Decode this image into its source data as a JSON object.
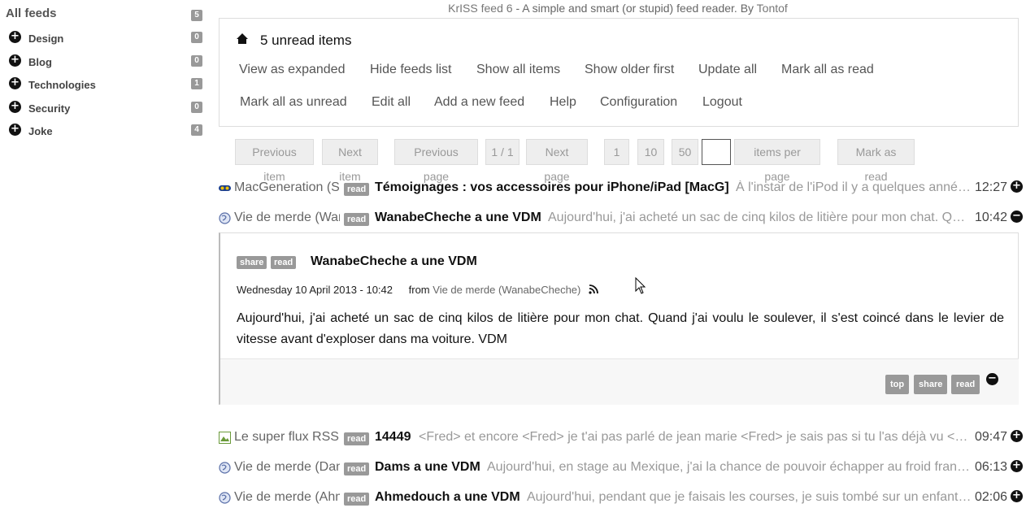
{
  "sidebar": {
    "all_feeds": "All feeds",
    "all_count": "5",
    "folders": [
      {
        "label": "Design",
        "count": "0"
      },
      {
        "label": "Blog",
        "count": "0"
      },
      {
        "label": "Technologies",
        "count": "1"
      },
      {
        "label": "Security",
        "count": "0"
      },
      {
        "label": "Joke",
        "count": "4"
      }
    ]
  },
  "header": {
    "app_name": "KrISS feed 6",
    "tagline": " - A simple and smart (or stupid) feed reader. By ",
    "author": "Tontof"
  },
  "menu": {
    "unread_title": "5 unread items",
    "row1": [
      "View as expanded",
      "Hide feeds list",
      "Show all items",
      "Show older first",
      "Update all",
      "Mark all as read"
    ],
    "row2": [
      "Mark all as unread",
      "Edit all",
      "Add a new feed",
      "Help",
      "Configuration",
      "Logout"
    ]
  },
  "pager": {
    "previous_item": "Previous item",
    "next_item": "Next item",
    "previous_page": "Previous page",
    "page_info": "1 / 1",
    "next_page": "Next page",
    "per_page_1": "1",
    "per_page_10": "10",
    "per_page_50": "50",
    "items_per_page": "items per page",
    "mark_as_read": "Mark as read"
  },
  "items": [
    {
      "feed": "MacGeneration (S",
      "tag": "read",
      "title": "Témoignages : vos accessoires pour iPhone/iPad [MacG]",
      "excerpt": "À l'instar de l'iPod il y a quelques années, l'iPhone et l'iPad ont créé tout un écosystème",
      "time": "12:27",
      "toggle": "+"
    },
    {
      "feed": "Vie de merde (WanabeCheche)",
      "tag": "read",
      "title": "WanabeCheche a une VDM",
      "excerpt": "Aujourd'hui, j'ai acheté un sac de cinq kilos de litière pour mon chat. Quand j'ai voulu",
      "time": "10:42",
      "toggle": "−"
    },
    {
      "feed": "Le super flux RSS",
      "tag": "read",
      "title": "14449",
      "excerpt": "<Fred> et encore <Fred> je t'ai pas parlé de jean marie <Fred> je sais pas si tu l'as déjà vu <Fred>",
      "time": "09:47",
      "toggle": "+"
    },
    {
      "feed": "Vie de merde (Dams)",
      "tag": "read",
      "title": "Dams a une VDM",
      "excerpt": "Aujourd'hui, en stage au Mexique, j'ai la chance de pouvoir échapper au froid français",
      "time": "06:13",
      "toggle": "+"
    },
    {
      "feed": "Vie de merde (Ahmedouch)",
      "tag": "read",
      "title": "Ahmedouch a une VDM",
      "excerpt": "Aujourd'hui, pendant que je faisais les courses, je suis tombé sur un enfant qui",
      "time": "02:06",
      "toggle": "+"
    }
  ],
  "article": {
    "share": "share",
    "read": "read",
    "title": "WanabeCheche a une VDM",
    "date": "Wednesday 10 April 2013 - 10:42",
    "from_label": "from",
    "feed": "Vie de merde (WanabeCheche)",
    "body": "Aujourd'hui, j'ai acheté un sac de cinq kilos de litière pour mon chat. Quand j'ai voulu le soulever, il s'est coincé dans le levier de vitesse avant d'exploser dans ma voiture. VDM",
    "footer_top": "top",
    "footer_share": "share",
    "footer_read": "read"
  }
}
